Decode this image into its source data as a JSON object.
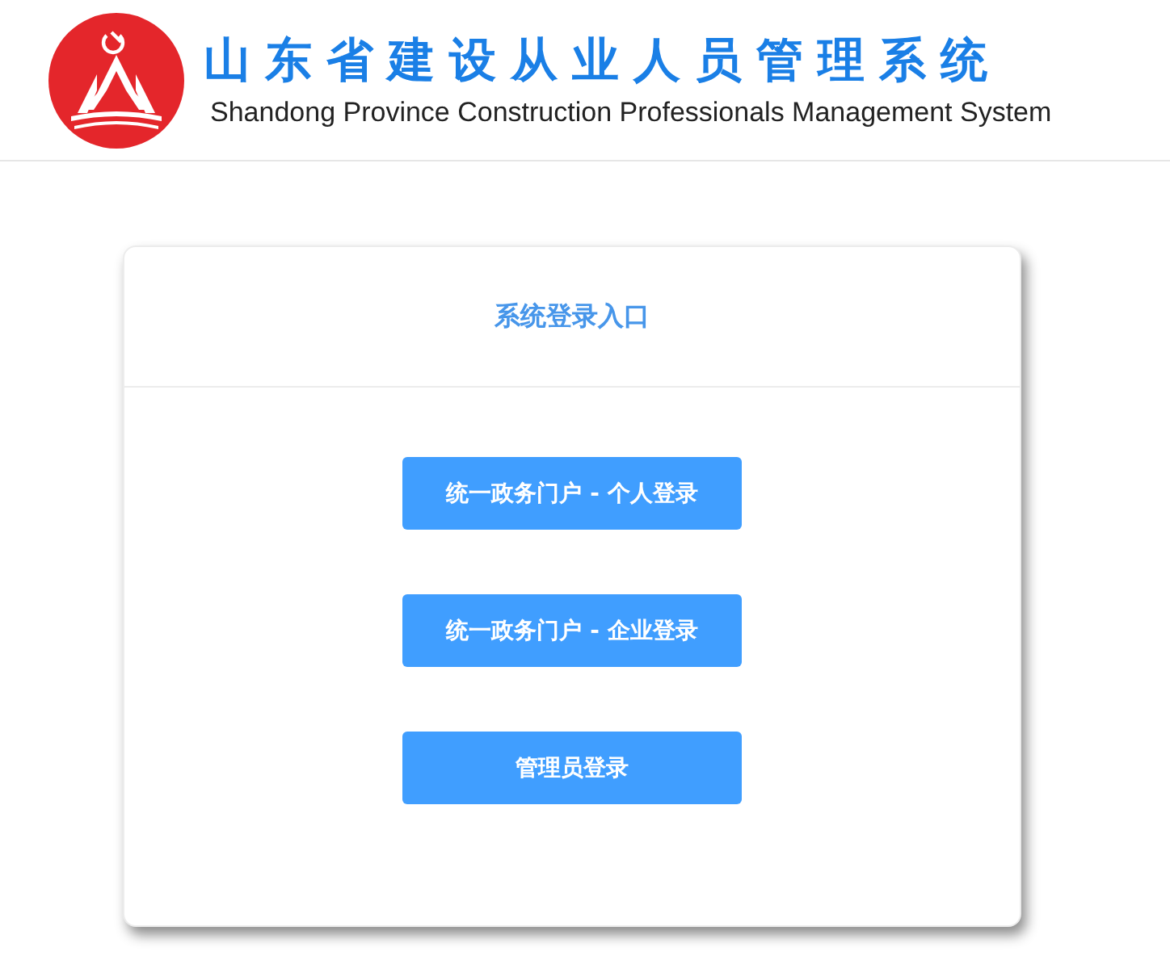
{
  "header": {
    "title": "山东省建设从业人员管理系统",
    "subtitle": "Shandong Province Construction Professionals Management System"
  },
  "login_card": {
    "title": "系统登录入口",
    "buttons": [
      {
        "label": "统一政务门户 - 个人登录"
      },
      {
        "label": "统一政务门户 - 企业登录"
      },
      {
        "label": "管理员登录"
      }
    ]
  }
}
